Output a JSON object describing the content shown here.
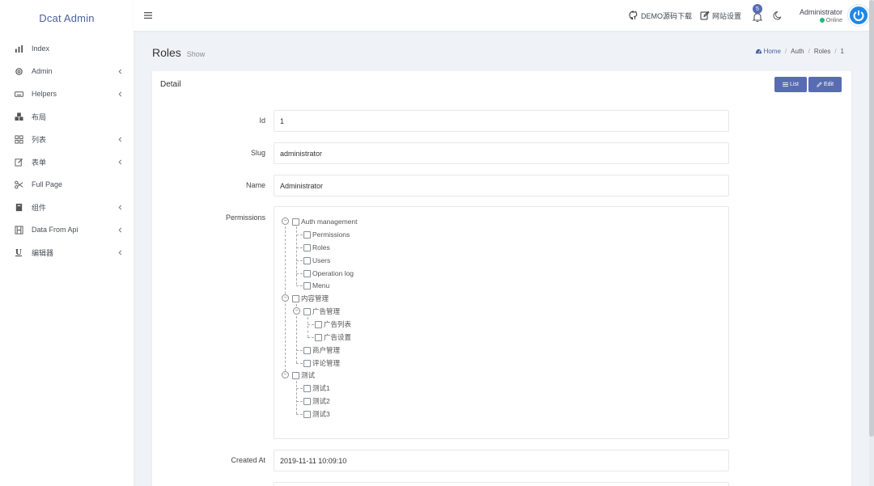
{
  "app": {
    "brand": "Dcat Admin"
  },
  "sidebar": {
    "items": [
      {
        "label": "Index",
        "icon": "bar-chart-icon",
        "has_children": false
      },
      {
        "label": "Admin",
        "icon": "gear-icon",
        "has_children": true
      },
      {
        "label": "Helpers",
        "icon": "keyboard-icon",
        "has_children": true
      },
      {
        "label": "布局",
        "icon": "cubes-icon",
        "has_children": false
      },
      {
        "label": "列表",
        "icon": "grid-icon",
        "has_children": true
      },
      {
        "label": "表单",
        "icon": "edit-icon",
        "has_children": true
      },
      {
        "label": "Full Page",
        "icon": "scissors-icon",
        "has_children": false
      },
      {
        "label": "组件",
        "icon": "book-icon",
        "has_children": true
      },
      {
        "label": "Data From Api",
        "icon": "film-icon",
        "has_children": true
      },
      {
        "label": "编辑器",
        "icon": "underline-icon",
        "has_children": true
      }
    ]
  },
  "topbar": {
    "demo_link": "DEMO源码下载",
    "settings_link": "网站设置",
    "notification_count": "5",
    "user_name": "Administrator",
    "user_status": "Online"
  },
  "page": {
    "title": "Roles",
    "subtitle": "Show",
    "breadcrumb": [
      "Home",
      "Auth",
      "Roles",
      "1"
    ]
  },
  "card": {
    "title": "Detail",
    "list_button": "List",
    "edit_button": "Edit"
  },
  "fields": {
    "id_label": "Id",
    "id_value": "1",
    "slug_label": "Slug",
    "slug_value": "administrator",
    "name_label": "Name",
    "name_value": "Administrator",
    "permissions_label": "Permissions",
    "created_label": "Created At",
    "created_value": "2019-11-11 10:09:10"
  },
  "permissions": {
    "auth": "Auth management",
    "permissions": "Permissions",
    "roles": "Roles",
    "users": "Users",
    "operation_log": "Operation log",
    "menu": "Menu",
    "content": "内容管理",
    "ads": "广告管理",
    "ad_list": "广告列表",
    "ad_settings": "广告设置",
    "merchants": "商户管理",
    "comments": "评论管理",
    "test": "测试",
    "test1": "测试1",
    "test2": "测试2",
    "test3": "测试3"
  },
  "colors": {
    "accent": "#586cb1",
    "brand": "#4c60a3",
    "online": "#21b978",
    "avatar": "#1e88e5"
  }
}
